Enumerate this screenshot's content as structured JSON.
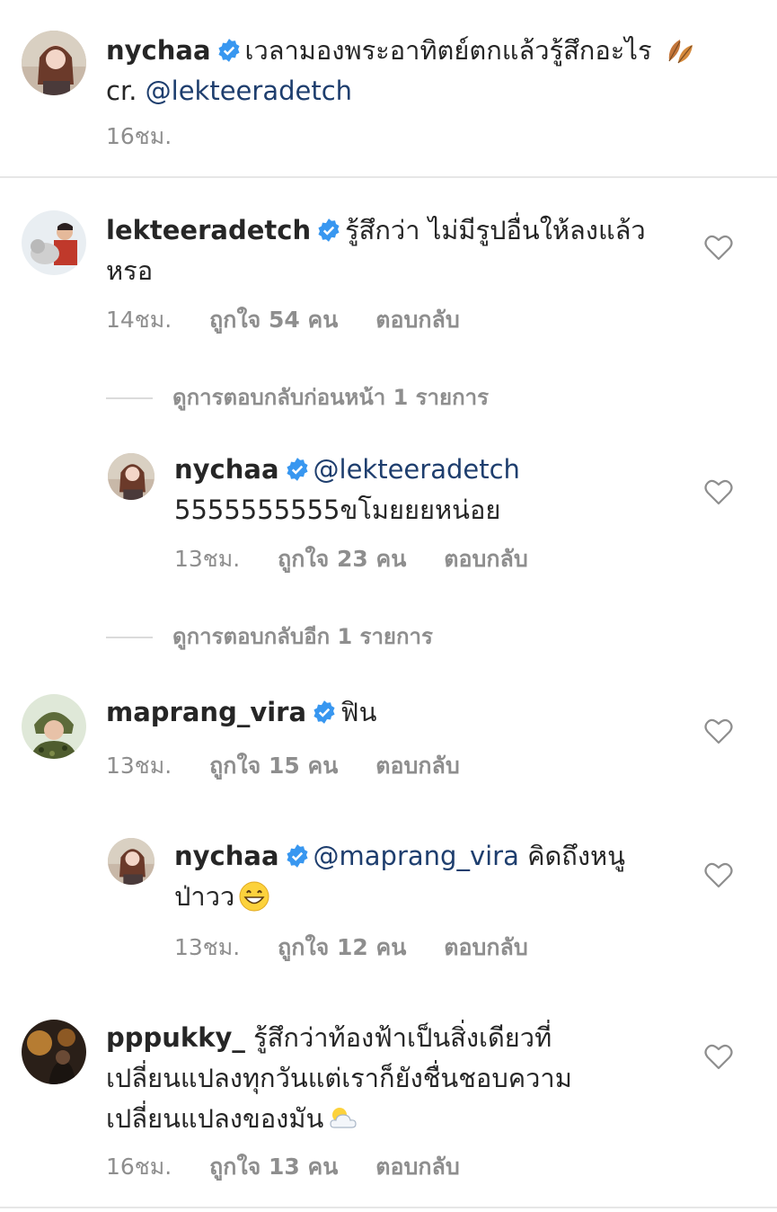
{
  "caption": {
    "username": "nychaa",
    "text": "เวลามองพระอาทิตย์ตกแล้วรู้สึกอะไร",
    "emoji": "leaves-emoji",
    "credit_prefix": "cr. ",
    "credit_mention": "@lekteeradetch",
    "time": "16ชม."
  },
  "comments": [
    {
      "username": "lekteeradetch",
      "text": "รู้สึกว่า ไม่มีรูปอื่นให้ลงแล้ว",
      "text2": "หรอ",
      "time": "14ชม.",
      "likes": "ถูกใจ 54 คน",
      "reply": "ตอบกลับ",
      "view_replies": "ดูการตอบกลับก่อนหน้า 1 รายการ",
      "reply_item": {
        "username": "nychaa",
        "mention": "@lekteeradetch",
        "text": "5555555555ขโมยยยหน่อย",
        "time": "13ชม.",
        "likes": "ถูกใจ 23 คน",
        "reply": "ตอบกลับ"
      },
      "view_more": "ดูการตอบกลับอีก 1 รายการ"
    },
    {
      "username": "maprang_vira",
      "text": "ฟิน",
      "time": "13ชม.",
      "likes": "ถูกใจ 15 คน",
      "reply": "ตอบกลับ",
      "reply_item": {
        "username": "nychaa",
        "mention": "@maprang_vira",
        "text": " คิดถึงหนู",
        "text2": "ป่าวว",
        "emoji": "grinning-emoji",
        "time": "13ชม.",
        "likes": "ถูกใจ 12 คน",
        "reply": "ตอบกลับ"
      }
    },
    {
      "username": "pppukky_",
      "text": "รู้สึกว่าท้องฟ้าเป็นสิ่งเดียวที่",
      "text2": "เปลี่ยนแปลงทุกวันแต่เราก็ยังชื่นชอบความ",
      "text3": "เปลี่ยนแปลงของมัน",
      "emoji": "sun-behind-cloud-emoji",
      "time": "16ชม.",
      "likes": "ถูกใจ 13 คน",
      "reply": "ตอบกลับ"
    }
  ],
  "colors": {
    "verified": "#3897f0",
    "mention": "#1e3e6e",
    "meta": "#8e8e8e"
  }
}
